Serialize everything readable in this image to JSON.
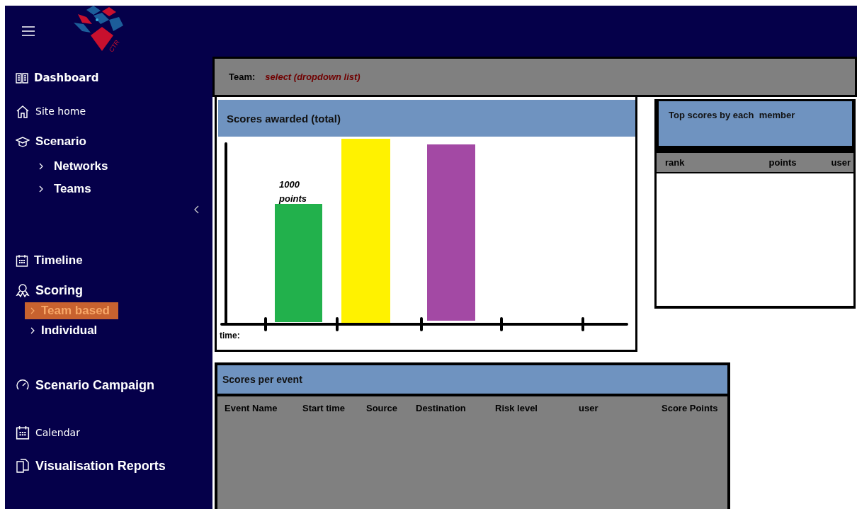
{
  "logo": {
    "text": "CTR"
  },
  "sidebar": {
    "items": [
      {
        "label": "Dashboard",
        "selected": false
      },
      {
        "label": "Site home",
        "selected": false
      },
      {
        "label": "Scenario",
        "selected": false,
        "children": [
          {
            "label": "Networks",
            "selected": false
          },
          {
            "label": "Teams",
            "selected": false
          }
        ]
      },
      {
        "label": "Timeline",
        "selected": false
      },
      {
        "label": "Scoring",
        "selected": false,
        "children": [
          {
            "label": "Team based",
            "selected": true
          },
          {
            "label": "Individual",
            "selected": false
          }
        ]
      },
      {
        "label": "Scenario Campaign",
        "selected": false
      },
      {
        "label": "Calendar",
        "selected": false
      },
      {
        "label": "Visualisation Reports",
        "selected": false
      }
    ]
  },
  "team_bar": {
    "label": "Team:",
    "value": "select (dropdown list)"
  },
  "scores_chart": {
    "title": "Scores awarded (total)",
    "bar_label": "1000 points",
    "x_label": "time:"
  },
  "top_scores": {
    "title": "Top scores by each  member",
    "columns": [
      "rank",
      "points",
      "user"
    ]
  },
  "events": {
    "title": "Scores per event",
    "columns": [
      "Event Name",
      "Start time",
      "Source",
      "Destination",
      "Risk level",
      "user",
      "Score Points"
    ]
  }
}
